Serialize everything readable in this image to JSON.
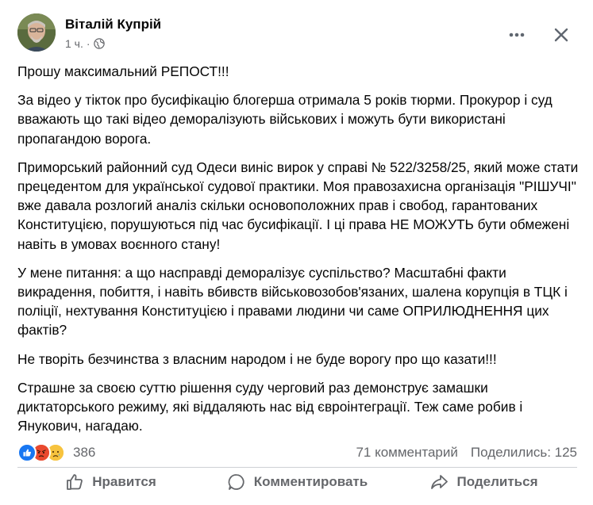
{
  "post": {
    "author": "Віталій Купрій",
    "time": "1 ч.",
    "paragraphs": [
      "Прошу максимальний РЕПОСТ!!!",
      "За відео у тікток про бусифікацію блогерша отримала 5 років тюрми. Прокурор і суд вважають що такі відео деморалізують військових і можуть бути використані пропагандою ворога.",
      "Приморський районний суд Одеси виніс вирок у справі № 522/3258/25, який може стати прецедентом для української судової практики. Моя правозахисна організація \"РІШУЧІ\" вже давала розлогий аналіз скільки основоположних прав і свобод, гарантованих Конституцією, порушуються під час бусифікації. І ці права НЕ МОЖУТЬ бути обмежені навіть в умовах воєнного стану!",
      "У мене питання: а що насправді деморалізує суспільство? Масштабні факти викрадення, побиття, і навіть вбивств військовозобов'язаних, шалена корупція в ТЦК і поліції, нехтування Конституцією і правами людини чи саме ОПРИЛЮДНЕННЯ цих фактів?",
      "Не творіть безчинства з власним народом і не буде ворогу про що казати!!!",
      "Страшне за своєю суттю рішення суду черговий раз демонструє замашки диктаторського режиму, які віддаляють нас від євроінтеграції. Теж саме робив і Янукович, нагадаю."
    ]
  },
  "stats": {
    "reactions": "386",
    "comments": "71 комментарий",
    "shares": "Поделились: 125"
  },
  "actions": {
    "like": "Нравится",
    "comment": "Комментировать",
    "share": "Поделиться"
  },
  "colors": {
    "like_blue": "#1877f2",
    "angry_orange": "#f0743b",
    "sad_yellow": "#f7c33e",
    "secondary_text": "#65676b"
  },
  "icons": {
    "privacy": "globe-icon",
    "more": "more-icon",
    "close": "close-icon",
    "like": "thumbs-up-icon",
    "comment": "comment-icon",
    "share": "share-icon"
  }
}
